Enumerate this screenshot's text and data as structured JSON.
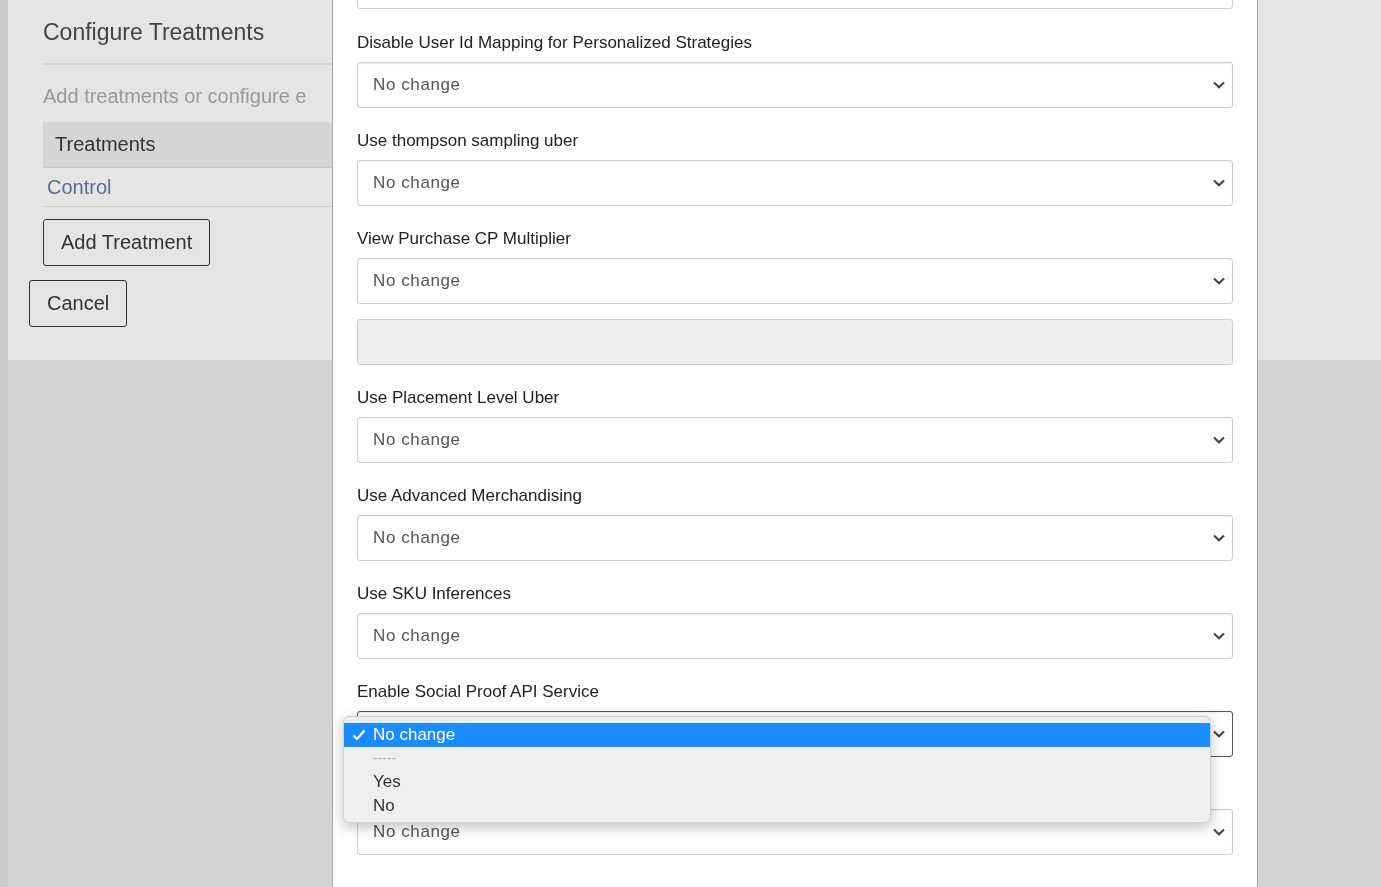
{
  "page": {
    "title": "Configure Treatments",
    "subtitle": "Add treatments or configure e",
    "table": {
      "header": "Treatments",
      "rows": [
        {
          "label": "Control"
        }
      ]
    },
    "buttons": [
      "Add Treatment",
      "Cancel"
    ]
  },
  "modal": {
    "fields": [
      {
        "kind": "select"
      },
      {
        "kind": "select",
        "label": "Disable User Id Mapping for Personalized Strategies",
        "value": "No change"
      },
      {
        "kind": "select",
        "label": "Use thompson sampling uber",
        "value": "No change"
      },
      {
        "kind": "select",
        "label": "View Purchase CP Multiplier",
        "value": "No change"
      },
      {
        "kind": "text",
        "disabled": true
      },
      {
        "kind": "select",
        "label": "Use Placement Level Uber",
        "value": "No change"
      },
      {
        "kind": "select",
        "label": "Use Advanced Merchandising",
        "value": "No change"
      },
      {
        "kind": "select",
        "label": "Use SKU Inferences",
        "value": "No change"
      },
      {
        "kind": "select",
        "label": "Enable Social Proof API Service",
        "open": true,
        "options": [
          {
            "label": "No change",
            "selected": true,
            "disabled": false
          },
          {
            "label": "-----",
            "selected": false,
            "disabled": true
          },
          {
            "label": "Yes",
            "selected": false,
            "disabled": false
          },
          {
            "label": "No",
            "selected": false,
            "disabled": false
          }
        ]
      },
      {
        "kind": "select",
        "value": "No change"
      }
    ]
  }
}
